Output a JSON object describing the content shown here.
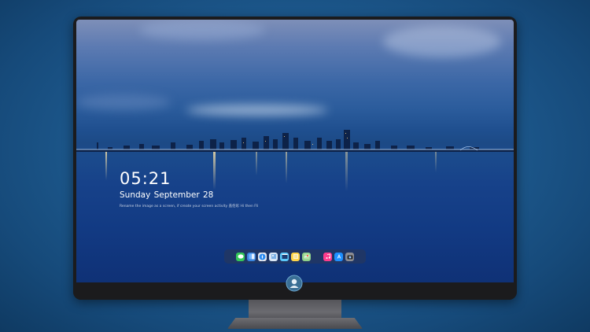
{
  "lock_screen": {
    "time": "05:21",
    "date": "Sunday September  28",
    "hint": "Rename the image as a screen, if create your screen activity  盖伦彩  Hi then Fli"
  },
  "dock": {
    "icons": [
      "messages-icon",
      "finder-icon",
      "safari-icon",
      "preview-icon",
      "photos-icon",
      "notes-icon",
      "maps-icon",
      "music-icon",
      "app-store-icon",
      "camera-icon"
    ]
  },
  "colors": {
    "background": "#1f5d93",
    "bezel": "#1b1b1d",
    "chin": "#2c2c30",
    "stand": "#5e5e63"
  }
}
